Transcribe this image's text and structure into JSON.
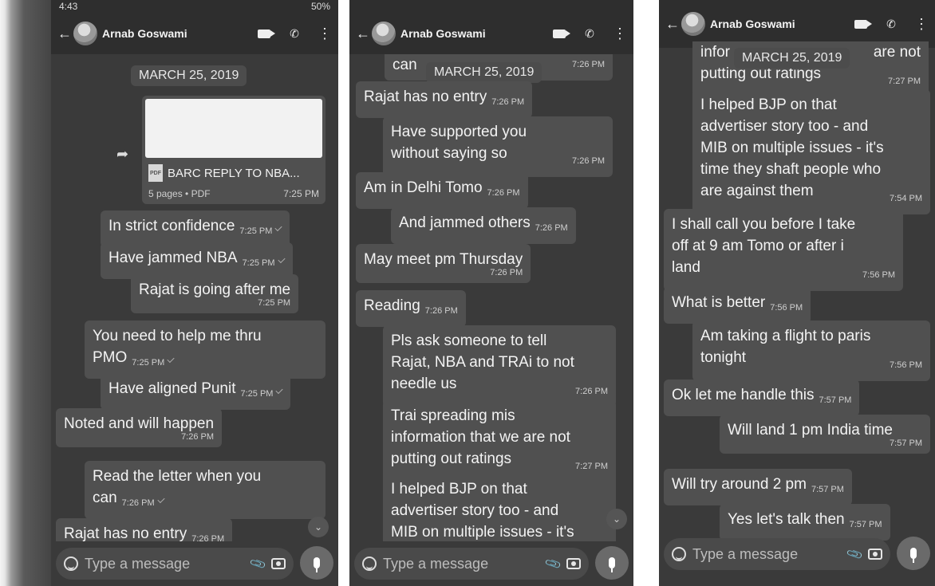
{
  "contact_name": "Arnab Goswami",
  "input_placeholder": "Type a message",
  "status_left": "4:43",
  "status_right": "50%",
  "date_label": "MARCH 25, 2019",
  "document": {
    "name": "BARC REPLY TO NBA...",
    "meta": "5 pages • PDF",
    "time": "7:25 PM",
    "icon_label": "PDF"
  },
  "panel1": [
    {
      "text": "In strict confidence",
      "time": "7:25 PM"
    },
    {
      "text": "Have jammed NBA",
      "time": "7:25 PM"
    },
    {
      "text": "Rajat is going after me",
      "time": "7:25 PM"
    },
    {
      "text": "You need to help me thru\nPMO",
      "time": "7:25 PM"
    },
    {
      "text": "Have aligned Punit",
      "time": "7:25 PM"
    },
    {
      "text": "Noted and will happen",
      "time": "7:26 PM"
    },
    {
      "text": "Read the letter when you\ncan",
      "time": "7:26 PM"
    },
    {
      "text": "Rajat has no entry",
      "time": "7:26 PM"
    }
  ],
  "panel2": [
    {
      "text": "can",
      "time": "7:26 PM"
    },
    {
      "text": "Rajat has no entry",
      "time": "7:26 PM"
    },
    {
      "text": "Have supported you\nwithout saying so",
      "time": "7:26 PM"
    },
    {
      "text": "Am in Delhi Tomo",
      "time": "7:26 PM"
    },
    {
      "text": "And jammed others",
      "time": "7:26 PM"
    },
    {
      "text": "May meet pm Thursday",
      "time": "7:26 PM"
    },
    {
      "text": "Reading",
      "time": "7:26 PM"
    },
    {
      "text": "Pls ask someone to tell\nRajat, NBA and TRAi to not\nneedle us",
      "time": "7:26 PM"
    },
    {
      "text": "Trai spreading mis\ninformation that we are not\nputting out ratings",
      "time": "7:27 PM"
    },
    {
      "text": "I helped BJP on that\nadvertiser story too - and\nMIB on multiple issues - it's",
      "time": ""
    }
  ],
  "panel3": [
    {
      "text": "infor",
      "tail": "are not",
      "line2": "putting out ratings",
      "time": "7:27 PM"
    },
    {
      "text": "I helped BJP on that\nadvertiser story too - and\nMIB on multiple issues - it's\ntime they shaft people who\nare against them",
      "time": "7:54 PM"
    },
    {
      "text": "I shall call you before I take\noff at 9 am Tomo or after i\nland",
      "time": "7:56 PM"
    },
    {
      "text": "What is better",
      "time": "7:56 PM"
    },
    {
      "text": "Am taking a flight to paris\ntonight",
      "time": "7:56 PM"
    },
    {
      "text": "Ok let me handle this",
      "time": "7:57 PM"
    },
    {
      "text": "Will land 1 pm India time",
      "time": "7:57 PM"
    },
    {
      "text": "Will try around 2 pm",
      "time": "7:57 PM"
    },
    {
      "text": "Yes let's talk then",
      "time": "7:57 PM"
    }
  ]
}
